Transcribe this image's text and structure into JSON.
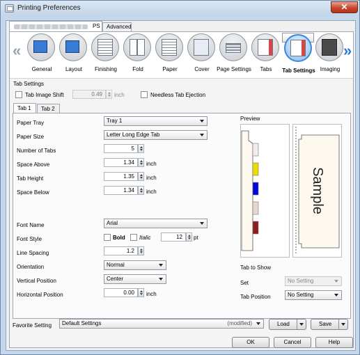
{
  "window": {
    "title": "Printing Preferences",
    "close": "✕"
  },
  "top_tabs": [
    {
      "label": "PS"
    },
    {
      "label": "Advanced"
    }
  ],
  "icons": [
    {
      "label": "General",
      "icon": "general-icon"
    },
    {
      "label": "Layout",
      "icon": "layout-icon"
    },
    {
      "label": "Finishing",
      "icon": "finishing-icon"
    },
    {
      "label": "Fold",
      "icon": "fold-icon"
    },
    {
      "label": "Paper",
      "icon": "paper-icon"
    },
    {
      "label": "Cover",
      "icon": "cover-icon"
    },
    {
      "label": "Page Settings",
      "icon": "page-settings-icon"
    },
    {
      "label": "Tabs",
      "icon": "tabs-icon"
    },
    {
      "label": "Tab Settings",
      "icon": "tab-settings-icon",
      "selected": true
    },
    {
      "label": "Imaging",
      "icon": "imaging-icon"
    }
  ],
  "nav": {
    "left": "«",
    "right": "»"
  },
  "tab_settings": {
    "group_label": "Tab Settings",
    "tab_image_shift_label": "Tab Image Shift",
    "tab_image_shift_value": "0.49",
    "tab_image_shift_unit": "inch",
    "needless_tab_ejection_label": "Needless Tab Ejection"
  },
  "inner_tabs": [
    "Tab 1",
    "Tab 2"
  ],
  "form": {
    "paper_tray_label": "Paper Tray",
    "paper_tray_value": "Tray 1",
    "paper_size_label": "Paper Size",
    "paper_size_value": "Letter Long Edge Tab",
    "number_of_tabs_label": "Number of Tabs",
    "number_of_tabs_value": "5",
    "space_above_label": "Space Above",
    "space_above_value": "1.34",
    "tab_height_label": "Tab Height",
    "tab_height_value": "1.35",
    "space_below_label": "Space Below",
    "space_below_value": "1.34",
    "unit": "inch",
    "font_name_label": "Font Name",
    "font_name_value": "Arial",
    "font_style_label": "Font Style",
    "bold_label": "Bold",
    "italic_label": "Italic",
    "font_size_value": "12",
    "font_size_unit": "pt",
    "line_spacing_label": "Line Spacing",
    "line_spacing_value": "1.2",
    "orientation_label": "Orientation",
    "orientation_value": "Normal",
    "vertical_position_label": "Vertical Position",
    "vertical_position_value": "Center",
    "horizontal_position_label": "Horizontal Position",
    "horizontal_position_value": "0.00"
  },
  "preview": {
    "label": "Preview",
    "sample_text": "Sample",
    "tab_colors": [
      "#f2ecec",
      "#e8dc00",
      "#0008e0",
      "#e6d6d0",
      "#8c1e22"
    ]
  },
  "tab_to_show": {
    "label": "Tab to Show",
    "set_label": "Set",
    "set_value": "No Setting",
    "position_label": "Tab Position",
    "position_value": "No Setting"
  },
  "footer": {
    "favorite_label": "Favorite Setting",
    "favorite_value": "Default Settings",
    "modified": "(modified)",
    "load": "Load",
    "save": "Save",
    "ok": "OK",
    "cancel": "Cancel",
    "help": "Help"
  }
}
